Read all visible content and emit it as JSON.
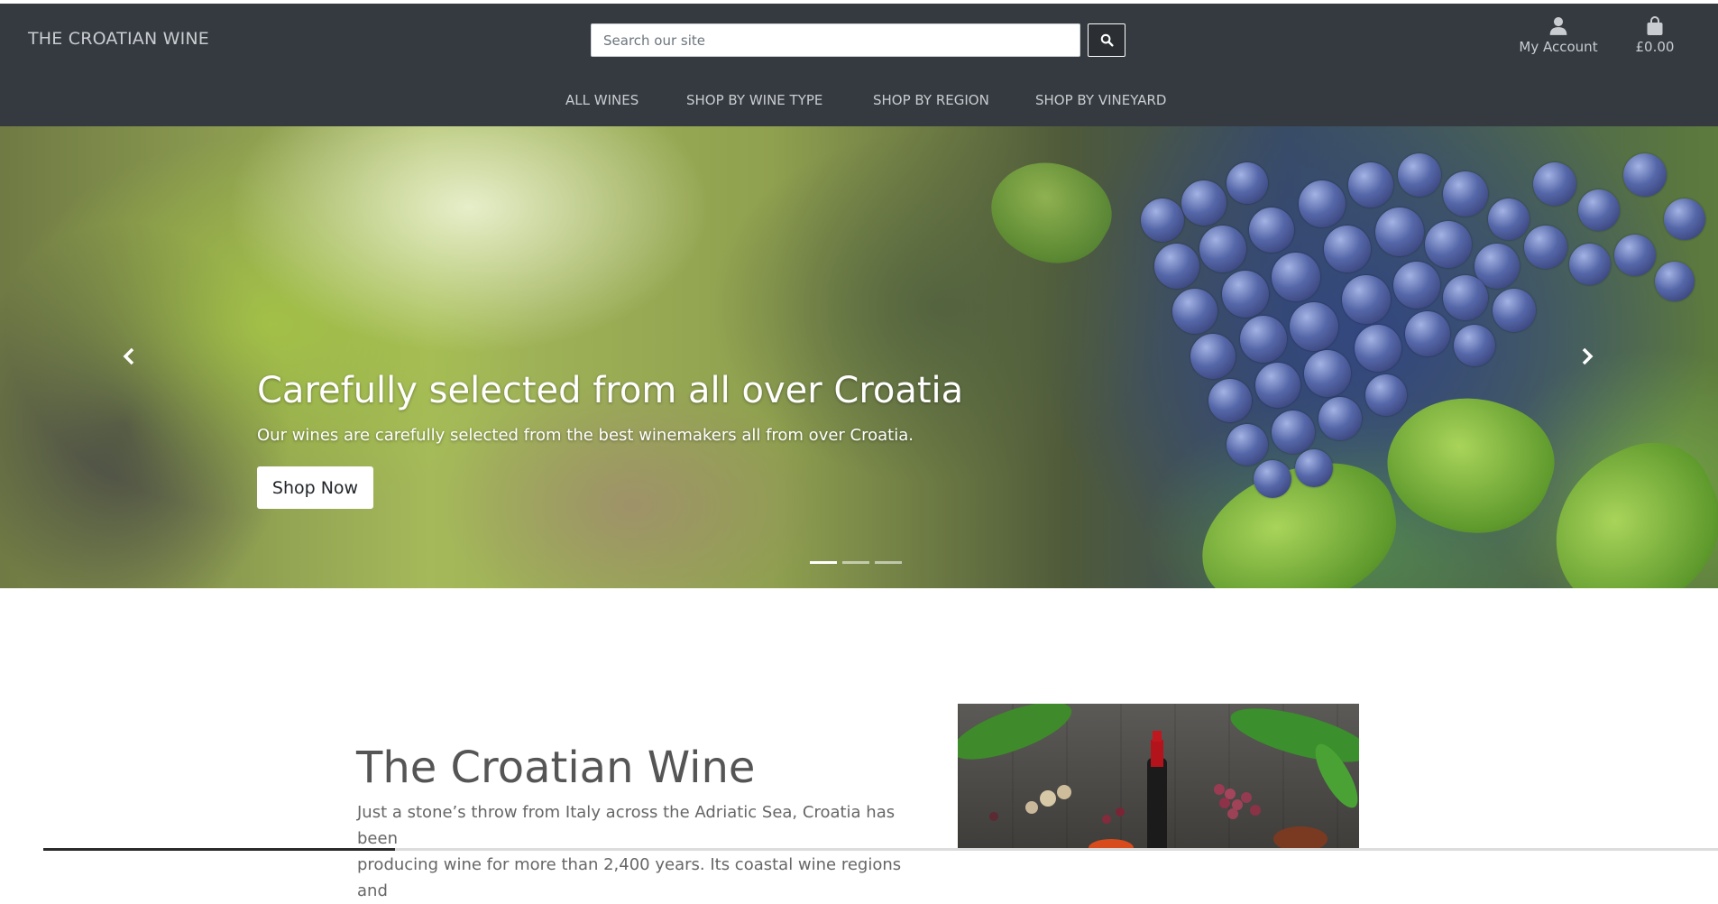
{
  "header": {
    "brand": "THE CROATIAN WINE",
    "search": {
      "placeholder": "Search our site",
      "value": ""
    },
    "search_icon": "search-icon",
    "account": {
      "label": "My Account",
      "icon": "user-icon"
    },
    "bag": {
      "total": "£0.00",
      "icon": "shopping-bag-icon"
    }
  },
  "nav": {
    "items": [
      {
        "label": "ALL WINES"
      },
      {
        "label": "SHOP BY WINE TYPE"
      },
      {
        "label": "SHOP BY REGION"
      },
      {
        "label": "SHOP BY VINEYARD"
      }
    ]
  },
  "hero": {
    "title": "Carefully selected from all over Croatia",
    "text": "Our wines are carefully selected from the best winemakers all from over Croatia.",
    "button": "Shop Now",
    "prev_icon": "chevron-left-icon",
    "next_icon": "chevron-right-icon",
    "slides": 3,
    "active_slide": 1
  },
  "about": {
    "title": "The Croatian Wine",
    "lines": [
      "Just a stone’s throw from Italy across the Adriatic Sea, Croatia has been",
      "producing wine for more than 2,400 years. Its coastal wine regions and"
    ]
  },
  "colors": {
    "header_bg": "#343a40",
    "header_text": "#c9ccd0",
    "hero_text": "#ffffff",
    "body_heading": "#555555"
  }
}
